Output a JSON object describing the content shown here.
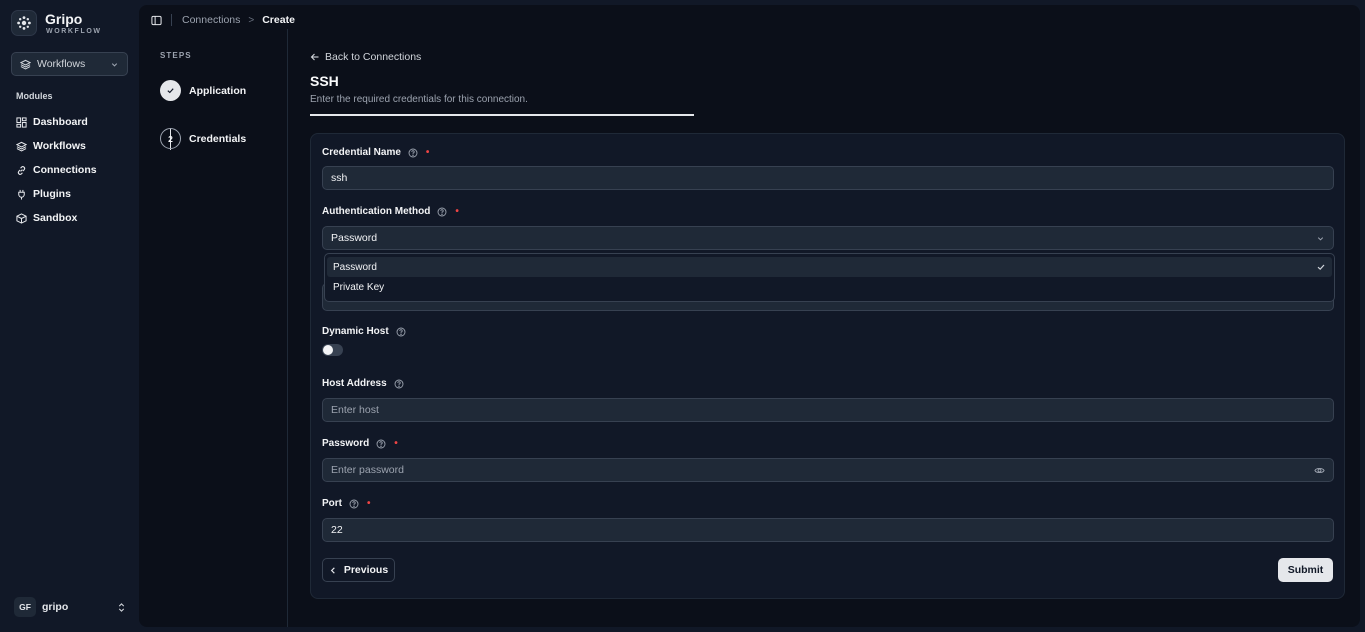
{
  "brand": {
    "name": "Gripo",
    "subtitle": "WORKFLOW"
  },
  "workspace": {
    "selected": "Workflows"
  },
  "sidebar": {
    "section_label": "Modules",
    "items": [
      {
        "label": "Dashboard",
        "icon": "dashboard-icon"
      },
      {
        "label": "Workflows",
        "icon": "layers-icon"
      },
      {
        "label": "Connections",
        "icon": "link-icon"
      },
      {
        "label": "Plugins",
        "icon": "plug-icon"
      },
      {
        "label": "Sandbox",
        "icon": "box-icon"
      }
    ]
  },
  "user": {
    "initials": "GF",
    "name": "gripo"
  },
  "breadcrumb": {
    "parent": "Connections",
    "separator": ">",
    "current": "Create"
  },
  "steps": {
    "label": "STEPS",
    "items": [
      {
        "label": "Application",
        "status": "done"
      },
      {
        "number": "2",
        "label": "Credentials",
        "status": "active"
      }
    ]
  },
  "header": {
    "back_label": "Back to Connections",
    "title": "SSH",
    "subtitle": "Enter the required credentials for this connection."
  },
  "form": {
    "credential_name": {
      "label": "Credential Name",
      "required": "•",
      "value": "ssh"
    },
    "auth_method": {
      "label": "Authentication Method",
      "required": "•",
      "value": "Password",
      "options": [
        "Password",
        "Private Key"
      ]
    },
    "dynamic_host": {
      "label": "Dynamic Host",
      "enabled": false
    },
    "host_address": {
      "label": "Host Address",
      "placeholder": "Enter host"
    },
    "password": {
      "label": "Password",
      "required": "•",
      "placeholder": "Enter password"
    },
    "port": {
      "label": "Port",
      "required": "•",
      "value": "22"
    }
  },
  "buttons": {
    "previous": "Previous",
    "submit": "Submit"
  },
  "colors": {
    "background": "#0b0f19",
    "surface": "#111827",
    "required": "#ef4444",
    "accent": "#e5e7eb"
  }
}
